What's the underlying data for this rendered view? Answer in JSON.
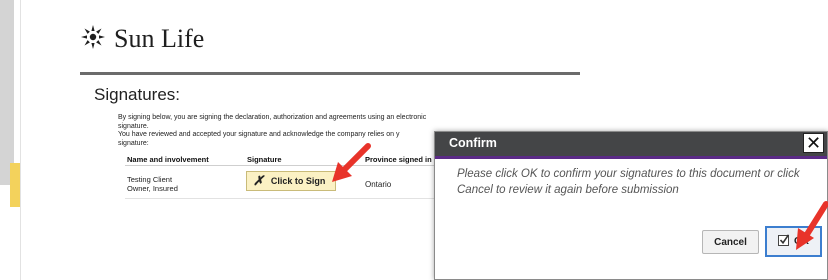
{
  "brand": {
    "name": "Sun Life"
  },
  "signatures": {
    "heading": "Signatures:",
    "body_lines": [
      "By signing below, you are signing the declaration, authorization and agreements using an electronic signature.",
      "You have reviewed and accepted your signature and acknowledge the company relies on y",
      "signature:"
    ],
    "columns": {
      "name": "Name and involvement",
      "signature": "Signature",
      "province": "Province signed in"
    },
    "rows": [
      {
        "name": "Testing Client",
        "involvement": "Owner, Insured",
        "sign_label": "Click to Sign",
        "province": "Ontario"
      }
    ]
  },
  "dialog": {
    "title": "Confirm",
    "message": "Please click OK to confirm your signatures to this document or click Cancel to review it again before submission",
    "cancel_label": "Cancel",
    "ok_label": "OK"
  },
  "colors": {
    "dialog_bar": "#444547",
    "dialog_accent": "#5b2a86",
    "ok_border": "#3c7ecf",
    "sign_button": "#fbf1c4",
    "annotation_arrow": "#e8332a"
  },
  "icons": {
    "brand_logo": "sun-logo-icon",
    "sign_mark": "x-mark-icon",
    "close": "close-icon",
    "ok": "checkbox-icon"
  }
}
